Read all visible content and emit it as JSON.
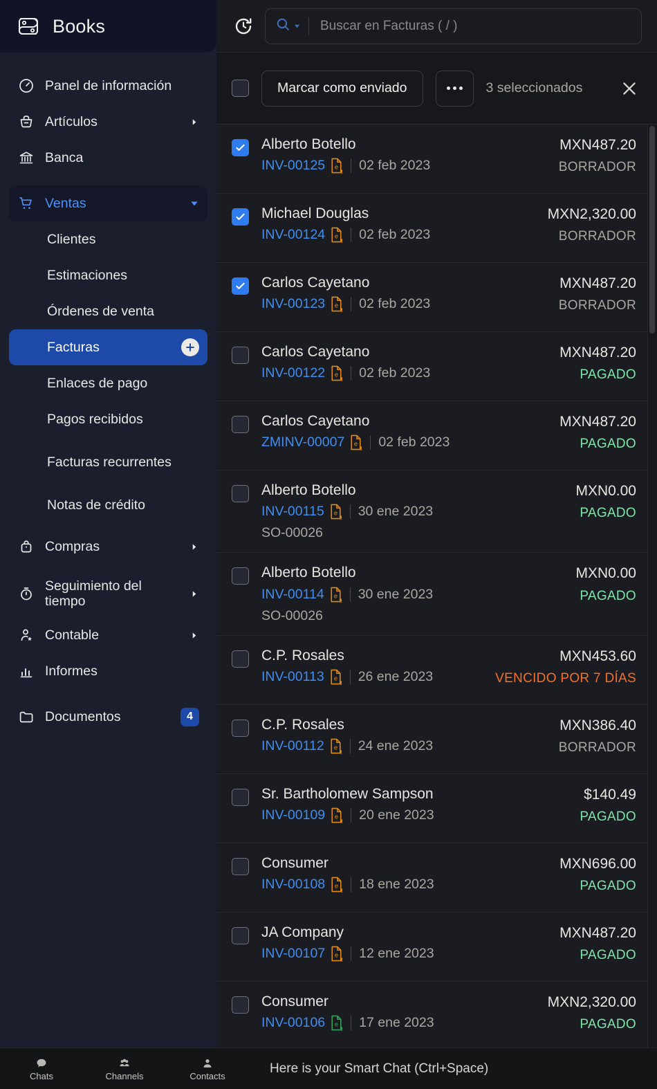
{
  "brand": {
    "name": "Books",
    "logo_icon": "books-logo-icon"
  },
  "sidebar": {
    "items": [
      {
        "label": "Panel de información",
        "icon": "dashboard-gauge-icon",
        "type": "item"
      },
      {
        "label": "Artículos",
        "icon": "basket-icon",
        "type": "expandable"
      },
      {
        "label": "Banca",
        "icon": "bank-icon",
        "type": "item"
      },
      {
        "label": "Ventas",
        "icon": "cart-icon",
        "type": "group-open"
      },
      {
        "label": "Compras",
        "icon": "bag-icon",
        "type": "expandable"
      },
      {
        "label": "Seguimiento del tiempo",
        "icon": "stopwatch-icon",
        "type": "expandable"
      },
      {
        "label": "Contable",
        "icon": "person-star-icon",
        "type": "expandable"
      },
      {
        "label": "Informes",
        "icon": "bar-chart-icon",
        "type": "item"
      },
      {
        "label": "Documentos",
        "icon": "folder-icon",
        "type": "item",
        "badge": "4"
      }
    ],
    "sales_children": [
      {
        "label": "Clientes",
        "active": false
      },
      {
        "label": "Estimaciones",
        "active": false
      },
      {
        "label": "Órdenes de venta",
        "active": false
      },
      {
        "label": "Facturas",
        "active": true,
        "add_icon": "plus-circle-icon"
      },
      {
        "label": "Enlaces de pago",
        "active": false
      },
      {
        "label": "Pagos recibidos",
        "active": false
      },
      {
        "label": "Facturas recurrentes",
        "active": false
      },
      {
        "label": "Notas de crédito",
        "active": false
      }
    ],
    "collapse_icon": "chevron-left-icon",
    "active_color": "#1d49a8",
    "accent_color": "#4f8ff7"
  },
  "topbar": {
    "history_icon": "history-clock-icon",
    "search_icon": "search-icon",
    "search_dropdown_icon": "caret-down-icon",
    "search_value": "",
    "search_placeholder": "Buscar en Facturas ( / )"
  },
  "selection_bar": {
    "select_all_checked": false,
    "mark_sent_label": "Marcar como enviado",
    "more_icon": "ellipsis-icon",
    "selected_text": "3 seleccionados",
    "close_icon": "close-icon"
  },
  "invoices": [
    {
      "name": "Alberto Botello",
      "number": "INV-00125",
      "doc_icon": "e-invoice-orange-icon",
      "date": "02 feb 2023",
      "amount": "MXN487.20",
      "status": "BORRADOR",
      "status_kind": "draft",
      "selected": true,
      "so": ""
    },
    {
      "name": "Michael Douglas",
      "number": "INV-00124",
      "doc_icon": "e-invoice-orange-icon",
      "date": "02 feb 2023",
      "amount": "MXN2,320.00",
      "status": "BORRADOR",
      "status_kind": "draft",
      "selected": true,
      "so": ""
    },
    {
      "name": "Carlos Cayetano",
      "number": "INV-00123",
      "doc_icon": "e-invoice-orange-icon",
      "date": "02 feb 2023",
      "amount": "MXN487.20",
      "status": "BORRADOR",
      "status_kind": "draft",
      "selected": true,
      "so": ""
    },
    {
      "name": "Carlos Cayetano",
      "number": "INV-00122",
      "doc_icon": "e-invoice-orange-icon",
      "date": "02 feb 2023",
      "amount": "MXN487.20",
      "status": "PAGADO",
      "status_kind": "paid",
      "selected": false,
      "so": ""
    },
    {
      "name": "Carlos Cayetano",
      "number": "ZMINV-00007",
      "doc_icon": "e-invoice-orange-icon",
      "date": "02 feb 2023",
      "amount": "MXN487.20",
      "status": "PAGADO",
      "status_kind": "paid",
      "selected": false,
      "so": ""
    },
    {
      "name": "Alberto Botello",
      "number": "INV-00115",
      "doc_icon": "e-invoice-orange-icon",
      "date": "30 ene 2023",
      "amount": "MXN0.00",
      "status": "PAGADO",
      "status_kind": "paid",
      "selected": false,
      "so": "SO-00026"
    },
    {
      "name": "Alberto Botello",
      "number": "INV-00114",
      "doc_icon": "e-invoice-orange-icon",
      "date": "30 ene 2023",
      "amount": "MXN0.00",
      "status": "PAGADO",
      "status_kind": "paid",
      "selected": false,
      "so": "SO-00026"
    },
    {
      "name": "C.P. Rosales",
      "number": "INV-00113",
      "doc_icon": "e-invoice-orange-icon",
      "date": "26 ene 2023",
      "amount": "MXN453.60",
      "status": "VENCIDO POR 7 DÍAS",
      "status_kind": "overdue",
      "selected": false,
      "so": ""
    },
    {
      "name": "C.P. Rosales",
      "number": "INV-00112",
      "doc_icon": "e-invoice-orange-icon",
      "date": "24 ene 2023",
      "amount": "MXN386.40",
      "status": "BORRADOR",
      "status_kind": "draft",
      "selected": false,
      "so": ""
    },
    {
      "name": "Sr. Bartholomew Sampson",
      "number": "INV-00109",
      "doc_icon": "e-invoice-orange-icon",
      "date": "20 ene 2023",
      "amount": "$140.49",
      "status": "PAGADO",
      "status_kind": "paid",
      "selected": false,
      "so": ""
    },
    {
      "name": "Consumer",
      "number": "INV-00108",
      "doc_icon": "e-invoice-orange-icon",
      "date": "18 ene 2023",
      "amount": "MXN696.00",
      "status": "PAGADO",
      "status_kind": "paid",
      "selected": false,
      "so": ""
    },
    {
      "name": "JA Company",
      "number": "INV-00107",
      "doc_icon": "e-invoice-orange-icon",
      "date": "12 ene 2023",
      "amount": "MXN487.20",
      "status": "PAGADO",
      "status_kind": "paid",
      "selected": false,
      "so": ""
    },
    {
      "name": "Consumer",
      "number": "INV-00106",
      "doc_icon": "e-invoice-green-icon",
      "date": "17 ene 2023",
      "amount": "MXN2,320.00",
      "status": "PAGADO",
      "status_kind": "paid",
      "selected": false,
      "so": ""
    }
  ],
  "bottom_bar": {
    "items": [
      {
        "label": "Chats",
        "icon": "chat-bubble-icon"
      },
      {
        "label": "Channels",
        "icon": "channels-group-icon"
      },
      {
        "label": "Contacts",
        "icon": "contact-person-icon"
      }
    ],
    "hint": "Here is your Smart Chat (Ctrl+Space)"
  },
  "colors": {
    "link": "#3f8ef0",
    "paid": "#7ee5a9",
    "overdue": "#f5702a",
    "draft": "#a9a7a0",
    "checkbox_on": "#2f7bf0"
  }
}
